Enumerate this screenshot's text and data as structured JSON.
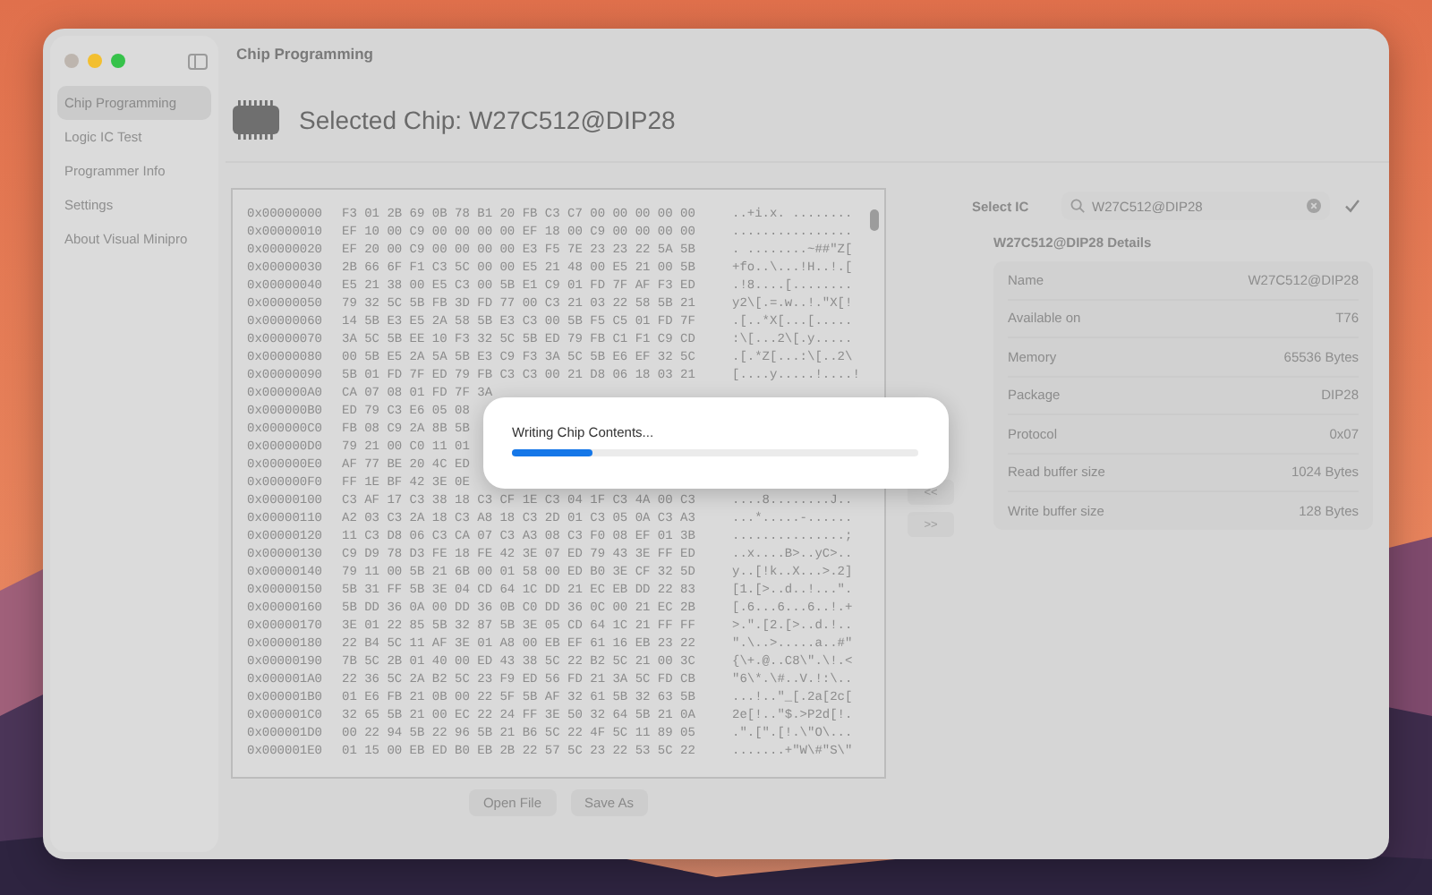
{
  "window": {
    "title": "Chip Programming"
  },
  "sidebar": {
    "items": [
      {
        "label": "Chip Programming",
        "selected": true
      },
      {
        "label": "Logic IC Test",
        "selected": false
      },
      {
        "label": "Programmer Info",
        "selected": false
      },
      {
        "label": "Settings",
        "selected": false
      },
      {
        "label": "About Visual Minipro",
        "selected": false
      }
    ]
  },
  "header": {
    "title": "Selected Chip: W27C512@DIP28"
  },
  "hex_rows": [
    {
      "address": "0x00000000",
      "bytes": "F3 01 2B 69 0B 78 B1 20 FB C3 C7 00 00 00 00 00",
      "ascii": "..+i.x. ........"
    },
    {
      "address": "0x00000010",
      "bytes": "EF 10 00 C9 00 00 00 00 EF 18 00 C9 00 00 00 00",
      "ascii": "................"
    },
    {
      "address": "0x00000020",
      "bytes": "EF 20 00 C9 00 00 00 00 E3 F5 7E 23 23 22 5A 5B",
      "ascii": ". ........~##\"Z["
    },
    {
      "address": "0x00000030",
      "bytes": "2B 66 6F F1 C3 5C 00 00 E5 21 48 00 E5 21 00 5B",
      "ascii": "+fo..\\...!H..!.["
    },
    {
      "address": "0x00000040",
      "bytes": "E5 21 38 00 E5 C3 00 5B E1 C9 01 FD 7F AF F3 ED",
      "ascii": ".!8....[........"
    },
    {
      "address": "0x00000050",
      "bytes": "79 32 5C 5B FB 3D FD 77 00 C3 21 03 22 58 5B 21",
      "ascii": "y2\\[.=.w..!.\"X[!"
    },
    {
      "address": "0x00000060",
      "bytes": "14 5B E3 E5 2A 58 5B E3 C3 00 5B F5 C5 01 FD 7F",
      "ascii": ".[..*X[...[....."
    },
    {
      "address": "0x00000070",
      "bytes": "3A 5C 5B EE 10 F3 32 5C 5B ED 79 FB C1 F1 C9 CD",
      "ascii": ":\\[...2\\[.y....."
    },
    {
      "address": "0x00000080",
      "bytes": "00 5B E5 2A 5A 5B E3 C9 F3 3A 5C 5B E6 EF 32 5C",
      "ascii": ".[.*Z[...:\\[..2\\"
    },
    {
      "address": "0x00000090",
      "bytes": "5B 01 FD 7F ED 79 FB C3 C3 00 21 D8 06 18 03 21",
      "ascii": "[....y.....!....!"
    },
    {
      "address": "0x000000A0",
      "bytes": "CA 07 08 01 FD 7F 3A"
    },
    {
      "address": "0x000000B0",
      "bytes": "ED 79 C3 E6 05 08"
    },
    {
      "address": "0x000000C0",
      "bytes": "FB 08 C9 2A 8B 5B"
    },
    {
      "address": "0x000000D0",
      "bytes": "79 21 00 C0 11 01"
    },
    {
      "address": "0x000000E0",
      "bytes": "AF 77 BE 20 4C ED"
    },
    {
      "address": "0x000000F0",
      "bytes": "FF 1E BF 42 3E 0E"
    },
    {
      "address": "0x00000100",
      "bytes": "C3 AF 17 C3 38 18 C3 CF 1E C3 04 1F C3 4A 00 C3",
      "ascii": "....8........J.."
    },
    {
      "address": "0x00000110",
      "bytes": "A2 03 C3 2A 18 C3 A8 18 C3 2D 01 C3 05 0A C3 A3",
      "ascii": "...*.....-......"
    },
    {
      "address": "0x00000120",
      "bytes": "11 C3 D8 06 C3 CA 07 C3 A3 08 C3 F0 08 EF 01 3B",
      "ascii": "...............;"
    },
    {
      "address": "0x00000130",
      "bytes": "C9 D9 78 D3 FE 18 FE 42 3E 07 ED 79 43 3E FF ED",
      "ascii": "..x....B>..yC>.."
    },
    {
      "address": "0x00000140",
      "bytes": "79 11 00 5B 21 6B 00 01 58 00 ED B0 3E CF 32 5D",
      "ascii": "y..[!k..X...>.2]"
    },
    {
      "address": "0x00000150",
      "bytes": "5B 31 FF 5B 3E 04 CD 64 1C DD 21 EC EB DD 22 83",
      "ascii": "[1.[>..d..!...\"."
    },
    {
      "address": "0x00000160",
      "bytes": "5B DD 36 0A 00 DD 36 0B C0 DD 36 0C 00 21 EC 2B",
      "ascii": "[.6...6...6..!.+"
    },
    {
      "address": "0x00000170",
      "bytes": "3E 01 22 85 5B 32 87 5B 3E 05 CD 64 1C 21 FF FF",
      "ascii": ">.\".[2.[>..d.!.."
    },
    {
      "address": "0x00000180",
      "bytes": "22 B4 5C 11 AF 3E 01 A8 00 EB EF 61 16 EB 23 22",
      "ascii": "\".\\..>.....a..#\""
    },
    {
      "address": "0x00000190",
      "bytes": "7B 5C 2B 01 40 00 ED 43 38 5C 22 B2 5C 21 00 3C",
      "ascii": "{\\+.@..C8\\\".\\!.<"
    },
    {
      "address": "0x000001A0",
      "bytes": "22 36 5C 2A B2 5C 23 F9 ED 56 FD 21 3A 5C FD CB",
      "ascii": "\"6\\*.\\#..V.!:\\.."
    },
    {
      "address": "0x000001B0",
      "bytes": "01 E6 FB 21 0B 00 22 5F 5B AF 32 61 5B 32 63 5B",
      "ascii": "...!..\"_[.2a[2c["
    },
    {
      "address": "0x000001C0",
      "bytes": "32 65 5B 21 00 EC 22 24 FF 3E 50 32 64 5B 21 0A",
      "ascii": "2e[!..\"$.>P2d[!."
    },
    {
      "address": "0x000001D0",
      "bytes": "00 22 94 5B 22 96 5B 21 B6 5C 22 4F 5C 11 89 05",
      "ascii": ".\".[\".[!.\\\"O\\..."
    },
    {
      "address": "0x000001E0",
      "bytes": "01 15 00 EB ED B0 EB 2B 22 57 5C 23 22 53 5C 22",
      "ascii": ".......+\"W\\#\"S\\\""
    }
  ],
  "file_buttons": [
    "Open File",
    "Save As"
  ],
  "nav_buttons": [
    "<<",
    ">>"
  ],
  "select_ic": {
    "label": "Select IC",
    "value": "W27C512@DIP28"
  },
  "details": {
    "title": "W27C512@DIP28 Details",
    "rows": [
      {
        "label": "Name",
        "value": "W27C512@DIP28"
      },
      {
        "label": "Available on",
        "value": "T76"
      },
      {
        "label": "Memory",
        "value": "65536 Bytes"
      },
      {
        "label": "Package",
        "value": "DIP28"
      },
      {
        "label": "Protocol",
        "value": "0x07"
      },
      {
        "label": "Read buffer size",
        "value": "1024 Bytes"
      },
      {
        "label": "Write buffer size",
        "value": "128 Bytes"
      }
    ]
  },
  "dialog": {
    "message": "Writing Chip Contents...",
    "level": 0.2
  }
}
